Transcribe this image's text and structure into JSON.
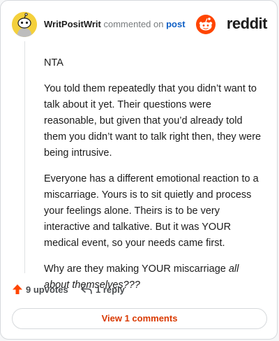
{
  "header": {
    "author": "WritPositWrit",
    "action": "commented on",
    "post_link": "post",
    "brand": "reddit"
  },
  "comment": {
    "paragraphs": [
      "NTA",
      "You told them repeatedly that you didn’t want to talk about it yet. Their questions were reasonable, but given that you’d already told them you didn’t want to talk right then, they were being intrusive.",
      "Everyone has a different emotional reaction to a miscarriage. Yours is to sit quietly and process your feelings alone. Theirs is to be very interactive and talkative. But it was YOUR medical event, so your needs came first."
    ],
    "last_paragraph_plain": "Why are they making YOUR miscarriage ",
    "last_paragraph_italic": "all about themselves???"
  },
  "actions": {
    "upvotes": "9 upvotes",
    "reply": "1 reply"
  },
  "view_comments": "View 1 comments",
  "colors": {
    "upvote": "#ff4500",
    "brand": "#ff4500",
    "link": "#0f60c6",
    "view_button_text": "#d93900"
  }
}
